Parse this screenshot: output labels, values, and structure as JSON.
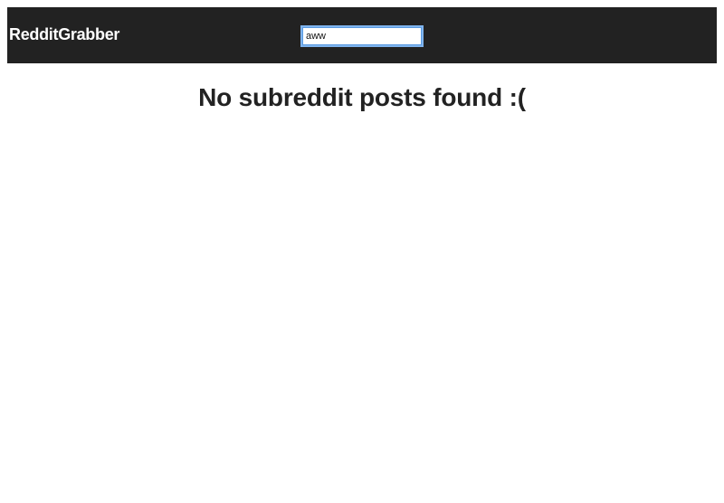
{
  "header": {
    "brand": "RedditGrabber",
    "search": {
      "value": "aww",
      "placeholder": ""
    }
  },
  "main": {
    "empty_message": "No subreddit posts found :("
  },
  "colors": {
    "header_background": "#222222",
    "header_text": "#ffffff",
    "body_text": "#222222",
    "focus_ring": "#5b9ae0"
  }
}
